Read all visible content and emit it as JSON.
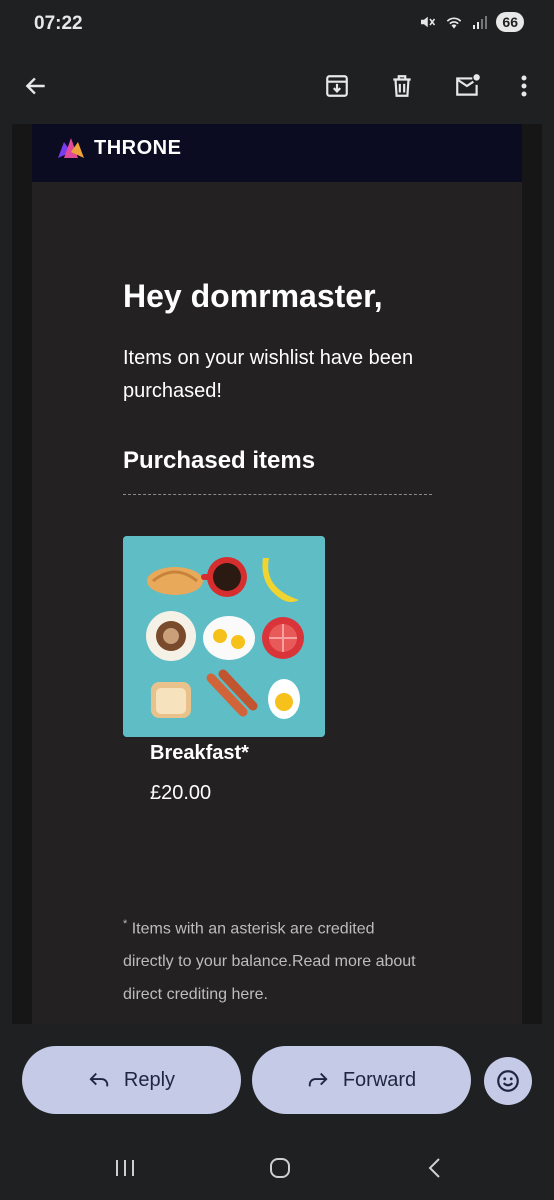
{
  "status_bar": {
    "time": "07:22",
    "battery": "66"
  },
  "app_bar": {
    "icons": [
      "back-arrow-icon",
      "archive-icon",
      "delete-icon",
      "mark-unread-icon",
      "more-options-icon"
    ]
  },
  "email": {
    "brand": "THRONE",
    "greeting": "Hey domrmaster,",
    "intro": "Items on your wishlist have been purchased!",
    "section_title": "Purchased items",
    "items": [
      {
        "name": "Breakfast*",
        "price": "£20.00"
      }
    ],
    "footnote_marker": "*",
    "footnote": " Items with an asterisk are credited directly to your balance.Read more about direct crediting here."
  },
  "actions": {
    "reply_label": "Reply",
    "forward_label": "Forward"
  },
  "colors": {
    "accent_button": "#c5cae6",
    "brand_header": "#0b0b22",
    "product_bg": "#5fbdc5"
  }
}
